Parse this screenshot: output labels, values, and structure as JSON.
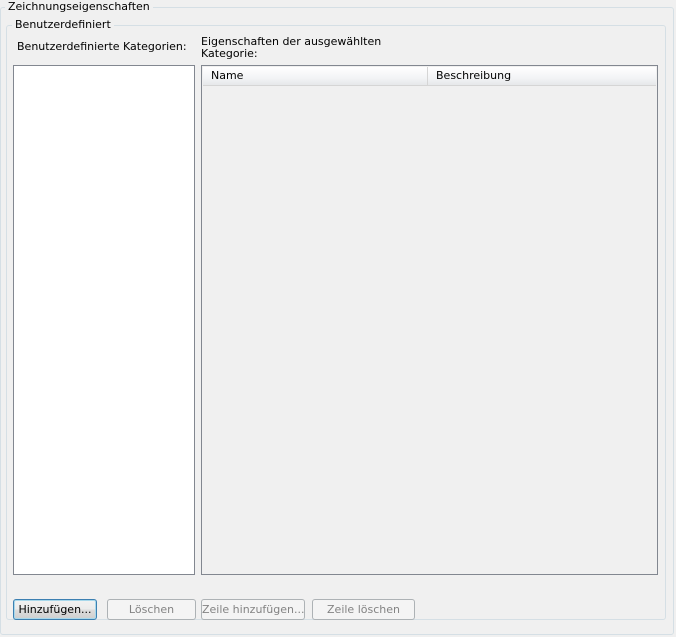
{
  "dialog": {
    "outer_group_title": "Zeichnungseigenschaften",
    "inner_group_title": "Benutzerdefiniert",
    "categories_label": "Benutzerdefinierte Kategorien:",
    "properties_label": "Eigenschaften der ausgewählten\nKategorie:"
  },
  "categories_list": {
    "items": []
  },
  "properties_table": {
    "columns": [
      "Name",
      "Beschreibung"
    ],
    "rows": []
  },
  "buttons": {
    "add": "Hinzufügen...",
    "delete": "Löschen",
    "add_row": "Zeile hinzufügen...",
    "delete_row": "Zeile löschen"
  }
}
